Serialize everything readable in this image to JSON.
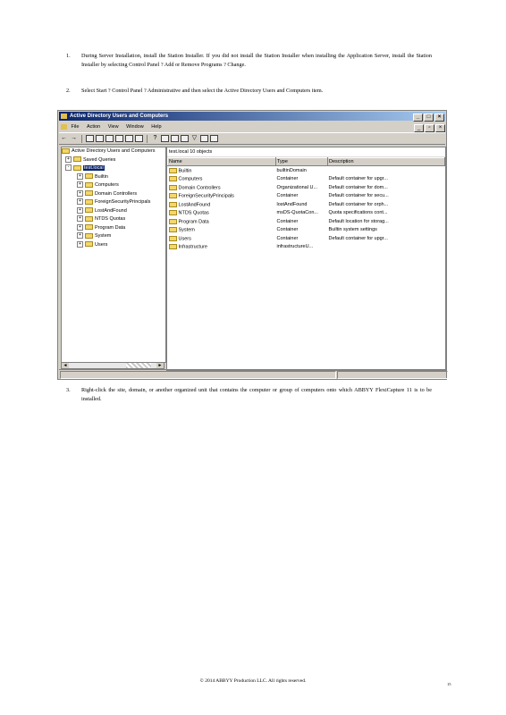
{
  "steps": [
    {
      "number": "1.",
      "text": "During Server Installation, install the Station Installer. If you did not install the Station Installer when installing the Application Server, install the Station Installer by selecting Control Panel ? Add or Remove Programs ? Change."
    },
    {
      "number": "2.",
      "text": "Select Start ? Control Panel ? Administrative and then select the Active Directory Users and Computers item."
    },
    {
      "number": "3.",
      "text": "Right-click the site, domain, or another organized unit that contains the computer or group of computers onto which ABBYY FlexiCapture 11 is to be installed."
    }
  ],
  "window": {
    "title": "Active Directory Users and Computers",
    "menu": [
      "File",
      "Action",
      "View",
      "Window",
      "Help"
    ],
    "tree_root": "Active Directory Users and Computers",
    "tree": [
      {
        "label": "Saved Queries",
        "expander": "+",
        "selected": false,
        "indent": 0
      },
      {
        "label": "test.local",
        "expander": "-",
        "selected": true,
        "indent": 0
      },
      {
        "label": "Builtin",
        "expander": "+",
        "selected": false,
        "indent": 1
      },
      {
        "label": "Computers",
        "expander": "+",
        "selected": false,
        "indent": 1
      },
      {
        "label": "Domain Controllers",
        "expander": "+",
        "selected": false,
        "indent": 1
      },
      {
        "label": "ForeignSecurityPrincipals",
        "expander": "+",
        "selected": false,
        "indent": 1
      },
      {
        "label": "LostAndFound",
        "expander": "+",
        "selected": false,
        "indent": 1
      },
      {
        "label": "NTDS Quotas",
        "expander": "+",
        "selected": false,
        "indent": 1
      },
      {
        "label": "Program Data",
        "expander": "+",
        "selected": false,
        "indent": 1
      },
      {
        "label": "System",
        "expander": "+",
        "selected": false,
        "indent": 1
      },
      {
        "label": "Users",
        "expander": "+",
        "selected": false,
        "indent": 1
      }
    ],
    "panel_title": "test.local   10 objects",
    "columns": [
      "Name",
      "Type",
      "Description"
    ],
    "rows": [
      {
        "name": "Builtin",
        "type": "builtinDomain",
        "description": ""
      },
      {
        "name": "Computers",
        "type": "Container",
        "description": "Default container for upgr..."
      },
      {
        "name": "Domain Controllers",
        "type": "Organizational U...",
        "description": "Default container for dom..."
      },
      {
        "name": "ForeignSecurityPrincipals",
        "type": "Container",
        "description": "Default container for secu..."
      },
      {
        "name": "LostAndFound",
        "type": "lostAndFound",
        "description": "Default container for orph..."
      },
      {
        "name": "NTDS Quotas",
        "type": "msDS-QuotaCon...",
        "description": "Quota specifications cont..."
      },
      {
        "name": "Program Data",
        "type": "Container",
        "description": "Default location for storag..."
      },
      {
        "name": "System",
        "type": "Container",
        "description": "Builtin system settings"
      },
      {
        "name": "Users",
        "type": "Container",
        "description": "Default container for upgr..."
      },
      {
        "name": "Infrastructure",
        "type": "infrastructureU...",
        "description": ""
      }
    ]
  },
  "footer": "© 2014 ABBYY Production LLC. All rights reserved.",
  "page_number": "15"
}
